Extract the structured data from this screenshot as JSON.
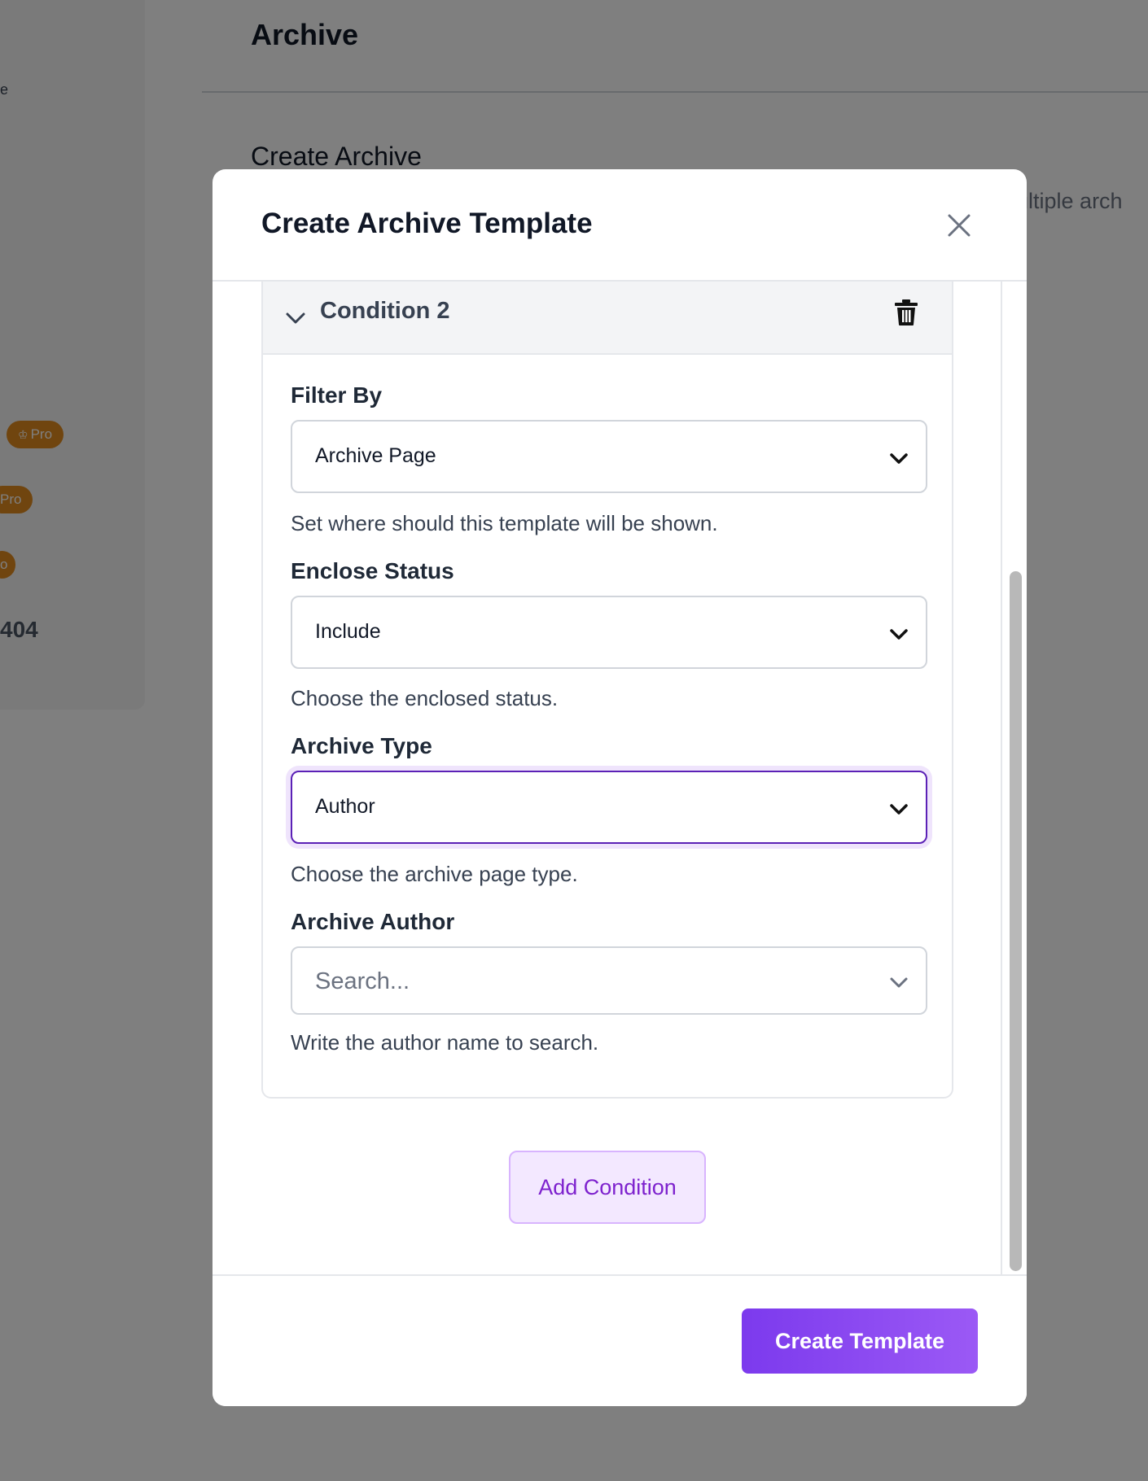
{
  "background": {
    "sidebar": {
      "cut_text": "e",
      "badges": [
        {
          "label": "Pro",
          "icon": "crown-icon"
        },
        {
          "label": "Pro"
        },
        {
          "label": "o"
        }
      ],
      "cut_404": "404"
    },
    "header_title": "Archive",
    "section_title": "Create Archive",
    "section_desc": "ultiple arch"
  },
  "modal": {
    "title": "Create Archive Template",
    "close_icon": "close-icon",
    "condition": {
      "title": "Condition 2",
      "delete_icon": "trash-icon"
    },
    "fields": {
      "filter_by": {
        "label": "Filter By",
        "value": "Archive Page",
        "help": "Set where should this template will be shown."
      },
      "enclose_status": {
        "label": "Enclose Status",
        "value": "Include",
        "help": "Choose the enclosed status."
      },
      "archive_type": {
        "label": "Archive Type",
        "value": "Author",
        "help": "Choose the archive page type."
      },
      "archive_author": {
        "label": "Archive Author",
        "placeholder": "Search...",
        "help": "Write the author name to search."
      }
    },
    "add_condition_label": "Add Condition",
    "create_button_label": "Create Template"
  },
  "colors": {
    "accent": "#7c3aed",
    "focus_border": "#5b21b6",
    "badge_orange": "#e08a1e",
    "add_condition_bg": "#f3e8ff"
  }
}
